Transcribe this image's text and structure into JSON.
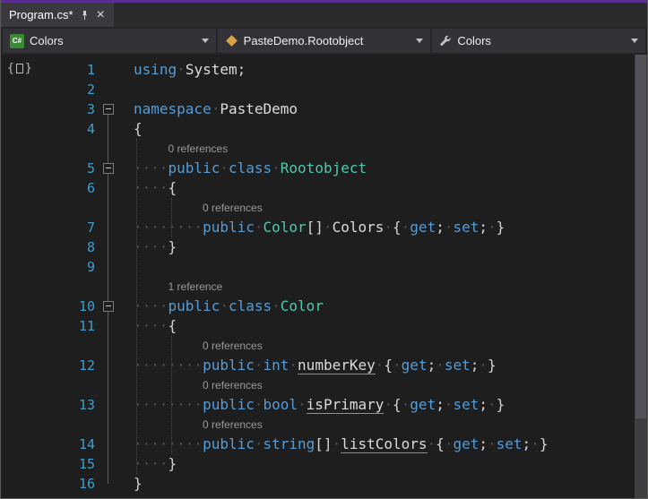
{
  "colors": {
    "accent": "#5C2D91",
    "keyword": "#569CD6",
    "type_name": "#4EC9B0",
    "line_number": "#3E9ECE",
    "codelens": "#9A9A9A",
    "whitespace_dot": "#4E4E55",
    "editor_background": "#1E1E1E",
    "chrome_background": "#2D2D30"
  },
  "tab_bar": {
    "tabs": [
      {
        "title": "Program.cs*",
        "pinned": true,
        "close_glyph": "×"
      }
    ]
  },
  "nav_bar": {
    "project_dropdown": {
      "label": "Colors",
      "icon": "csharp-file-icon",
      "icon_text": "C#"
    },
    "type_dropdown": {
      "label": "PasteDemo.Rootobject",
      "icon": "class-icon"
    },
    "member_dropdown": {
      "label": "Colors",
      "icon": "wrench-icon"
    }
  },
  "editor": {
    "glyph_icon": {
      "open": "{",
      "close": "}"
    },
    "rows": [
      {
        "kind": "code",
        "num": "1",
        "tokens": [
          {
            "t": "kw",
            "s": "using"
          },
          {
            "t": "ws",
            "n": 1
          },
          {
            "t": "id",
            "s": "System"
          },
          {
            "t": "punc",
            "s": ";"
          }
        ]
      },
      {
        "kind": "code",
        "num": "2",
        "tokens": []
      },
      {
        "kind": "code",
        "num": "3",
        "fold": true,
        "tokens": [
          {
            "t": "kw",
            "s": "namespace"
          },
          {
            "t": "ws",
            "n": 1
          },
          {
            "t": "id",
            "s": "PasteDemo"
          }
        ]
      },
      {
        "kind": "code",
        "num": "4",
        "tokens": [
          {
            "t": "punc",
            "s": "{"
          }
        ]
      },
      {
        "kind": "codelens",
        "indent": 4,
        "text": "0 references"
      },
      {
        "kind": "code",
        "num": "5",
        "fold": true,
        "tokens": [
          {
            "t": "ws",
            "n": 4
          },
          {
            "t": "kw",
            "s": "public"
          },
          {
            "t": "ws",
            "n": 1
          },
          {
            "t": "kw",
            "s": "class"
          },
          {
            "t": "ws",
            "n": 1
          },
          {
            "t": "type",
            "s": "Rootobject"
          }
        ]
      },
      {
        "kind": "code",
        "num": "6",
        "tokens": [
          {
            "t": "ws",
            "n": 4
          },
          {
            "t": "punc",
            "s": "{"
          }
        ]
      },
      {
        "kind": "codelens",
        "indent": 8,
        "text": "0 references"
      },
      {
        "kind": "code",
        "num": "7",
        "tokens": [
          {
            "t": "ws",
            "n": 8
          },
          {
            "t": "kw",
            "s": "public"
          },
          {
            "t": "ws",
            "n": 1
          },
          {
            "t": "type",
            "s": "Color"
          },
          {
            "t": "punc",
            "s": "[]"
          },
          {
            "t": "ws",
            "n": 1
          },
          {
            "t": "id",
            "s": "Colors"
          },
          {
            "t": "ws",
            "n": 1
          },
          {
            "t": "punc",
            "s": "{"
          },
          {
            "t": "ws",
            "n": 1
          },
          {
            "t": "kw",
            "s": "get"
          },
          {
            "t": "punc",
            "s": ";"
          },
          {
            "t": "ws",
            "n": 1
          },
          {
            "t": "kw",
            "s": "set"
          },
          {
            "t": "punc",
            "s": ";"
          },
          {
            "t": "ws",
            "n": 1
          },
          {
            "t": "punc",
            "s": "}"
          }
        ]
      },
      {
        "kind": "code",
        "num": "8",
        "tokens": [
          {
            "t": "ws",
            "n": 4
          },
          {
            "t": "punc",
            "s": "}"
          }
        ]
      },
      {
        "kind": "code",
        "num": "9",
        "tokens": []
      },
      {
        "kind": "codelens",
        "indent": 4,
        "text": "1 reference"
      },
      {
        "kind": "code",
        "num": "10",
        "fold": true,
        "tokens": [
          {
            "t": "ws",
            "n": 4
          },
          {
            "t": "kw",
            "s": "public"
          },
          {
            "t": "ws",
            "n": 1
          },
          {
            "t": "kw",
            "s": "class"
          },
          {
            "t": "ws",
            "n": 1
          },
          {
            "t": "type",
            "s": "Color"
          }
        ]
      },
      {
        "kind": "code",
        "num": "11",
        "tokens": [
          {
            "t": "ws",
            "n": 4
          },
          {
            "t": "punc",
            "s": "{"
          }
        ]
      },
      {
        "kind": "codelens",
        "indent": 8,
        "text": "0 references"
      },
      {
        "kind": "code",
        "num": "12",
        "tokens": [
          {
            "t": "ws",
            "n": 8
          },
          {
            "t": "kw",
            "s": "public"
          },
          {
            "t": "ws",
            "n": 1
          },
          {
            "t": "kw",
            "s": "int"
          },
          {
            "t": "ws",
            "n": 1
          },
          {
            "t": "uid",
            "s": "numberKey"
          },
          {
            "t": "ws",
            "n": 1
          },
          {
            "t": "punc",
            "s": "{"
          },
          {
            "t": "ws",
            "n": 1
          },
          {
            "t": "kw",
            "s": "get"
          },
          {
            "t": "punc",
            "s": ";"
          },
          {
            "t": "ws",
            "n": 1
          },
          {
            "t": "kw",
            "s": "set"
          },
          {
            "t": "punc",
            "s": ";"
          },
          {
            "t": "ws",
            "n": 1
          },
          {
            "t": "punc",
            "s": "}"
          }
        ]
      },
      {
        "kind": "codelens",
        "indent": 8,
        "text": "0 references"
      },
      {
        "kind": "code",
        "num": "13",
        "tokens": [
          {
            "t": "ws",
            "n": 8
          },
          {
            "t": "kw",
            "s": "public"
          },
          {
            "t": "ws",
            "n": 1
          },
          {
            "t": "kw",
            "s": "bool"
          },
          {
            "t": "ws",
            "n": 1
          },
          {
            "t": "uid",
            "s": "isPrimary"
          },
          {
            "t": "ws",
            "n": 1
          },
          {
            "t": "punc",
            "s": "{"
          },
          {
            "t": "ws",
            "n": 1
          },
          {
            "t": "kw",
            "s": "get"
          },
          {
            "t": "punc",
            "s": ";"
          },
          {
            "t": "ws",
            "n": 1
          },
          {
            "t": "kw",
            "s": "set"
          },
          {
            "t": "punc",
            "s": ";"
          },
          {
            "t": "ws",
            "n": 1
          },
          {
            "t": "punc",
            "s": "}"
          }
        ]
      },
      {
        "kind": "codelens",
        "indent": 8,
        "text": "0 references"
      },
      {
        "kind": "code",
        "num": "14",
        "tokens": [
          {
            "t": "ws",
            "n": 8
          },
          {
            "t": "kw",
            "s": "public"
          },
          {
            "t": "ws",
            "n": 1
          },
          {
            "t": "kw",
            "s": "string"
          },
          {
            "t": "punc",
            "s": "[]"
          },
          {
            "t": "ws",
            "n": 1
          },
          {
            "t": "uid",
            "s": "listColors"
          },
          {
            "t": "ws",
            "n": 1
          },
          {
            "t": "punc",
            "s": "{"
          },
          {
            "t": "ws",
            "n": 1
          },
          {
            "t": "kw",
            "s": "get"
          },
          {
            "t": "punc",
            "s": ";"
          },
          {
            "t": "ws",
            "n": 1
          },
          {
            "t": "kw",
            "s": "set"
          },
          {
            "t": "punc",
            "s": ";"
          },
          {
            "t": "ws",
            "n": 1
          },
          {
            "t": "punc",
            "s": "}"
          }
        ]
      },
      {
        "kind": "code",
        "num": "15",
        "tokens": [
          {
            "t": "ws",
            "n": 4
          },
          {
            "t": "punc",
            "s": "}"
          }
        ]
      },
      {
        "kind": "code",
        "num": "16",
        "tokens": [
          {
            "t": "punc",
            "s": "}"
          }
        ]
      }
    ]
  }
}
